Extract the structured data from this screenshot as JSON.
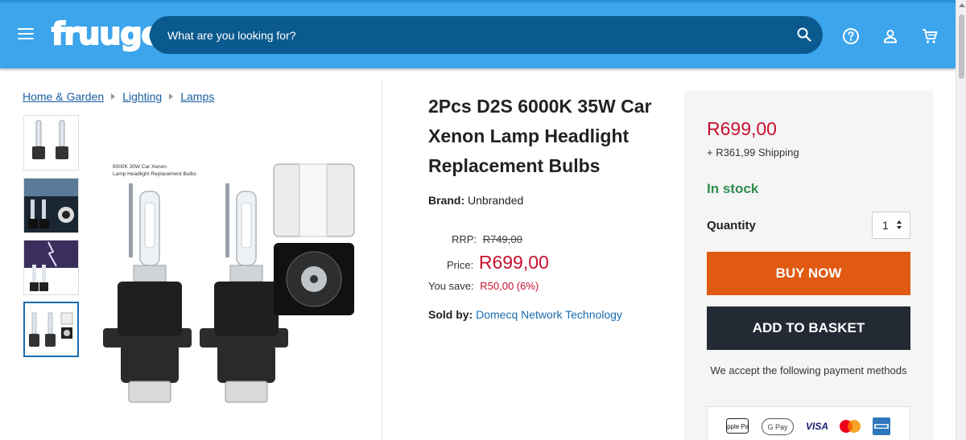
{
  "header": {
    "logo": "fruugo",
    "search_placeholder": "What are you looking for?"
  },
  "breadcrumb": [
    "Home & Garden",
    "Lighting",
    "Lamps"
  ],
  "product": {
    "title": "2Pcs D2S 6000K 35W Car Xenon Lamp Headlight Replacement Bulbs",
    "brand_label": "Brand:",
    "brand_value": "Unbranded",
    "image_caption_1": "6000K 35W Car Xenon",
    "image_caption_2": "Lamp Headlight Replacement Bulbs",
    "rrp_label": "RRP:",
    "rrp_value": "R749,00",
    "price_label": "Price:",
    "price_value": "R699,00",
    "save_label": "You save:",
    "save_value": "R50,00 (6%)",
    "sold_by_label": "Sold by:",
    "sold_by_value": "Domecq Network Technology"
  },
  "buybox": {
    "price": "R699,00",
    "shipping": "+ R361,99 Shipping",
    "stock": "In stock",
    "quantity_label": "Quantity",
    "quantity_value": "1",
    "buy_now": "BUY NOW",
    "add_to_basket": "ADD TO BASKET",
    "accept_text": "We accept the following payment methods",
    "payment_methods": [
      "Apple Pay",
      "G Pay",
      "VISA",
      "Mastercard",
      "American Express"
    ]
  },
  "icons": [
    "menu-icon",
    "search-icon",
    "help-icon",
    "account-icon",
    "cart-icon"
  ],
  "colors": {
    "header": "#3ca5eb",
    "search_bg": "#0b5a8f",
    "price": "#c8102e",
    "stock": "#2f8f4e",
    "buy_now": "#e05a12",
    "basket": "#232a34",
    "link": "#1a5fa0"
  }
}
